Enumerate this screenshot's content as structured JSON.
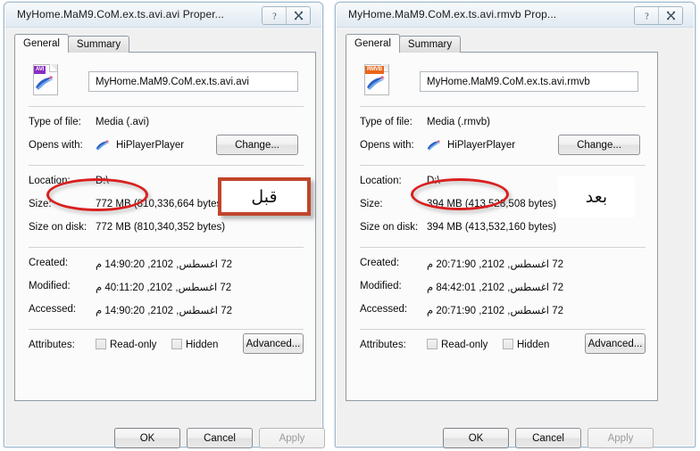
{
  "dialogs": [
    {
      "id": "left",
      "title": "MyHome.MaM9.CoM.ex.ts.avi.avi Proper...",
      "help_icon": "question-mark-icon",
      "close_icon": "close-icon",
      "tabs": [
        {
          "label": "General",
          "active": true
        },
        {
          "label": "Summary",
          "active": false
        }
      ],
      "file_icon_badge": "AVI",
      "file_name": "MyHome.MaM9.CoM.ex.ts.avi.avi",
      "fields": {
        "type_of_file_label": "Type of file:",
        "type_of_file_value": "Media (.avi)",
        "opens_with_label": "Opens with:",
        "opens_with_value": "HiPlayerPlayer",
        "change_button": "Change...",
        "location_label": "Location:",
        "location_value": "D:\\",
        "size_label": "Size:",
        "size_value": "772 MB (810,336,664 bytes)",
        "size_on_disk_label": "Size on disk:",
        "size_on_disk_value": "772 MB (810,340,352 bytes)",
        "created_label": "Created:",
        "created_value": "27 اغسطس, 2012, 02:09:41 م",
        "modified_label": "Modified:",
        "modified_value": "27 اغسطس, 2012, 02:11:04 م",
        "accessed_label": "Accessed:",
        "accessed_value": "27 اغسطس, 2012, 02:09:41 م",
        "attributes_label": "Attributes:",
        "readonly_label": "Read-only",
        "hidden_label": "Hidden",
        "advanced_button": "Advanced..."
      },
      "footer": {
        "ok": "OK",
        "cancel": "Cancel",
        "apply": "Apply",
        "apply_disabled": true
      },
      "annotation": {
        "text": "قبل",
        "style": "boxed",
        "border_color": "#c0452a"
      }
    },
    {
      "id": "right",
      "title": "MyHome.MaM9.CoM.ex.ts.avi.rmvb Prop...",
      "help_icon": "question-mark-icon",
      "close_icon": "close-icon",
      "tabs": [
        {
          "label": "General",
          "active": true
        },
        {
          "label": "Summary",
          "active": false
        }
      ],
      "file_icon_badge": "RMVB",
      "file_name": "MyHome.MaM9.CoM.ex.ts.avi.rmvb",
      "fields": {
        "type_of_file_label": "Type of file:",
        "type_of_file_value": "Media (.rmvb)",
        "opens_with_label": "Opens with:",
        "opens_with_value": "HiPlayerPlayer",
        "change_button": "Change...",
        "location_label": "Location:",
        "location_value": "D:\\",
        "size_label": "Size:",
        "size_value": "394 MB (413,528,508 bytes)",
        "size_on_disk_label": "Size on disk:",
        "size_on_disk_value": "394 MB (413,532,160 bytes)",
        "created_label": "Created:",
        "created_value": "27 اغسطس, 2012, 09:17:02 م",
        "modified_label": "Modified:",
        "modified_value": "27 اغسطس, 2012, 10:24:48 م",
        "accessed_label": "Accessed:",
        "accessed_value": "27 اغسطس, 2012, 09:17:02 م",
        "attributes_label": "Attributes:",
        "readonly_label": "Read-only",
        "hidden_label": "Hidden",
        "advanced_button": "Advanced..."
      },
      "footer": {
        "ok": "OK",
        "cancel": "Cancel",
        "apply": "Apply",
        "apply_disabled": true
      },
      "annotation": {
        "text": "بعد",
        "style": "plain",
        "border_color": "none"
      }
    }
  ],
  "colors": {
    "annotation_ellipse": "#d91f1f",
    "annotation_box_border": "#c0452a",
    "avi_badge": "#8a2fc0",
    "rmvb_badge": "#e8661a",
    "window_border": "#9bb7cc"
  }
}
